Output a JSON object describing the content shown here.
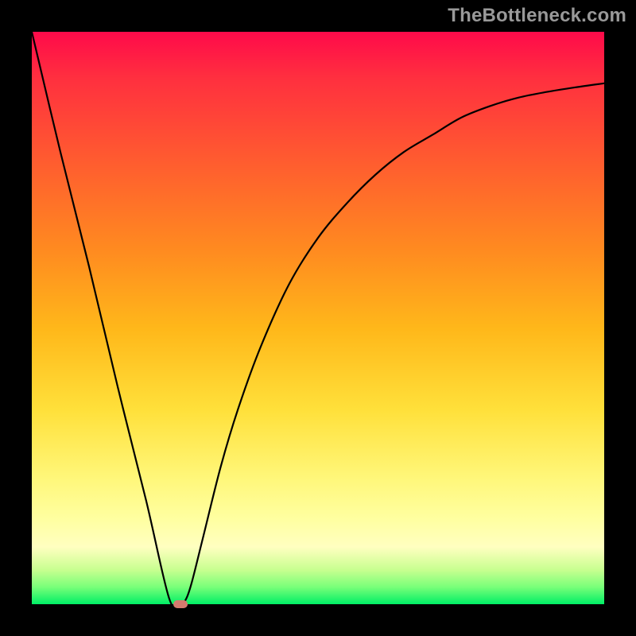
{
  "watermark": "TheBottleneck.com",
  "colors": {
    "frame": "#000000",
    "curve": "#000000",
    "marker": "#d47a6e",
    "gradient_stops": [
      "#ff0a4a",
      "#ff5a30",
      "#ffb81a",
      "#ffe03a",
      "#fff77a",
      "#79ff79",
      "#00ef66"
    ]
  },
  "chart_data": {
    "type": "line",
    "title": "",
    "xlabel": "",
    "ylabel": "",
    "xlim": [
      0,
      100
    ],
    "ylim": [
      0,
      100
    ],
    "grid": false,
    "legend": false,
    "series": [
      {
        "name": "curve",
        "x": [
          0,
          5,
          10,
          15,
          20,
          24,
          26,
          27,
          28,
          30,
          33,
          36,
          40,
          45,
          50,
          55,
          60,
          65,
          70,
          75,
          80,
          85,
          90,
          95,
          100
        ],
        "values": [
          100,
          79,
          59,
          38,
          18,
          1,
          0,
          1,
          4,
          12,
          24,
          34,
          45,
          56,
          64,
          70,
          75,
          79,
          82,
          85,
          87,
          88.5,
          89.5,
          90.3,
          91
        ]
      }
    ],
    "annotations": [
      {
        "name": "min-marker",
        "x": 26,
        "y": 0
      }
    ]
  }
}
